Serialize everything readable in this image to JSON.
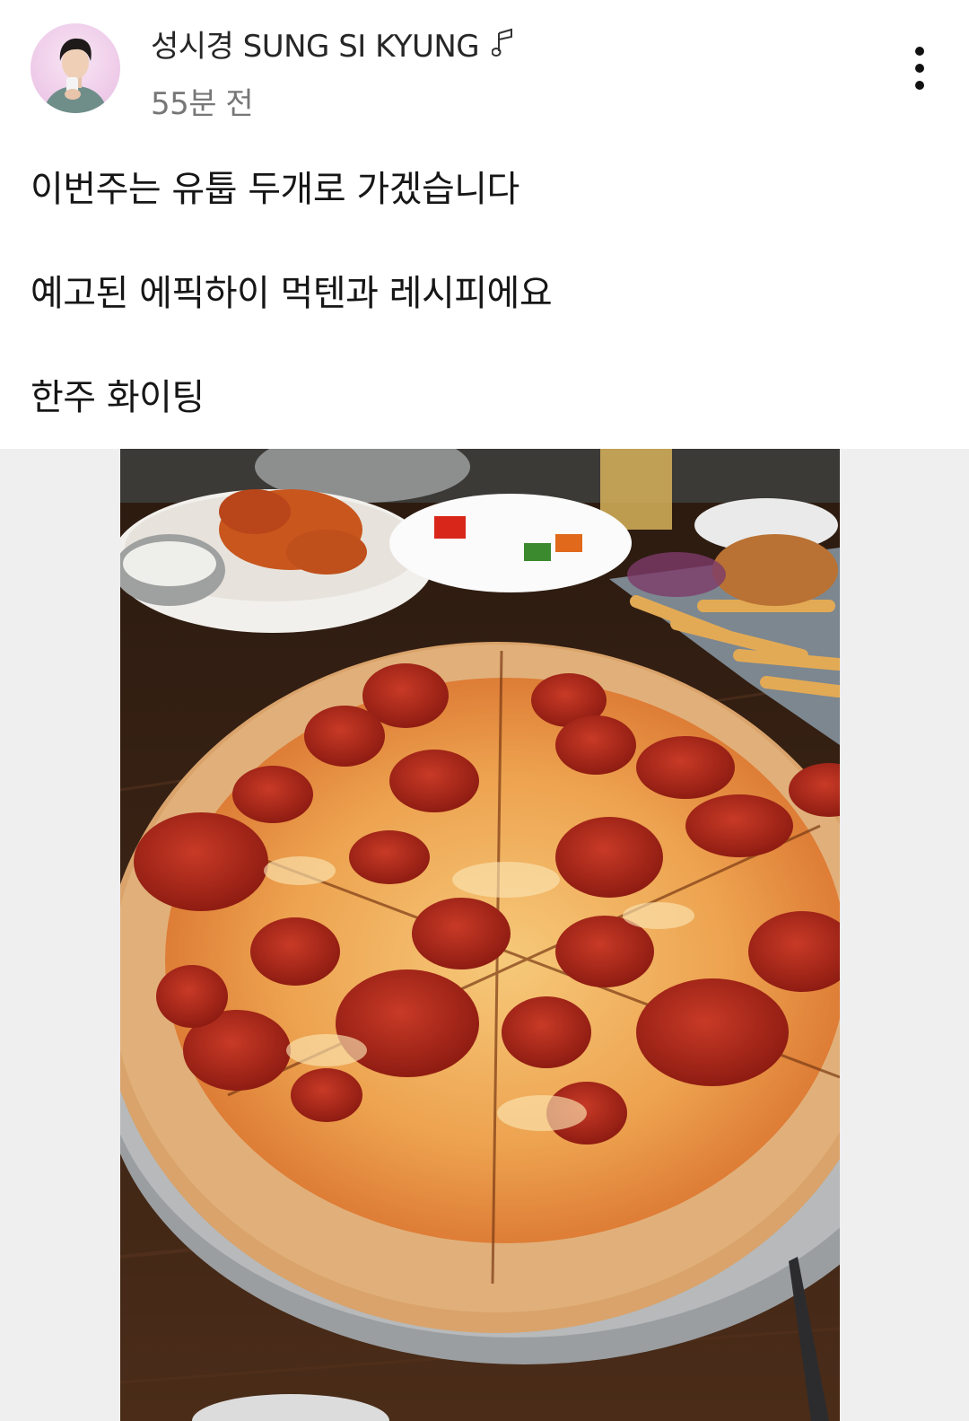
{
  "author": {
    "name": "성시경 SUNG SI KYUNG",
    "time": "55분 전",
    "badge_icon": "music-note-icon"
  },
  "menu_icon": "more-vertical-icon",
  "post": {
    "lines": [
      "이번주는 유툽 두개로 가겠습니다",
      "예고된 에픽하이 먹텐과 레시피에요",
      "한주 화이팅"
    ]
  },
  "photo": {
    "subject": "pepperoni pizza",
    "colors": {
      "table": "#3a2416",
      "crust": "#d9a36b",
      "cheese": "#f0b35a",
      "pepperoni": "#b42a1c",
      "backdrop": "#efefef"
    }
  }
}
